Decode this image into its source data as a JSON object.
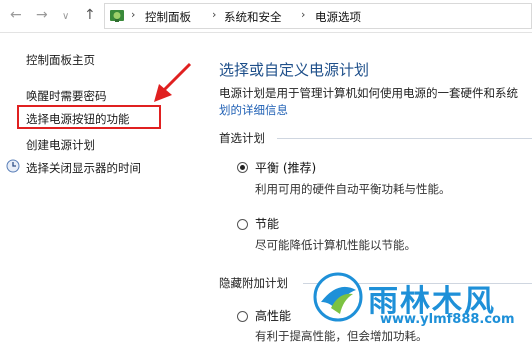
{
  "breadcrumb": {
    "items": [
      "控制面板",
      "系统和安全",
      "电源选项"
    ],
    "separator": "›"
  },
  "sidebar": {
    "items": [
      {
        "label": "控制面板主页"
      },
      {
        "label": "唤醒时需要密码"
      },
      {
        "label": "选择电源按钮的功能"
      },
      {
        "label": "创建电源计划"
      },
      {
        "label": "选择关闭显示器的时间"
      }
    ]
  },
  "main": {
    "title": "选择或自定义电源计划",
    "description": "电源计划是用于管理计算机如何使用电源的一套硬件和系统",
    "description_link": "划的详细信息",
    "preferred_heading": "首选计划",
    "plans": [
      {
        "name": "平衡 (推荐)",
        "desc": "利用可用的硬件自动平衡功耗与性能。",
        "checked": true
      },
      {
        "name": "节能",
        "desc": "尽可能降低计算机性能以节能。",
        "checked": false
      }
    ],
    "hidden_heading": "隐藏附加计划",
    "hidden_plans": [
      {
        "name": "高性能",
        "desc": "有利于提高性能，但会增加功耗。",
        "checked": false
      }
    ]
  },
  "watermark": {
    "brand": "雨林木风",
    "url": "www.ylmf888.com"
  },
  "colors": {
    "title_blue": "#1e4f8a",
    "link_blue": "#1e5fb4",
    "highlight_red": "#e02020",
    "watermark_blue": "#1e90d8",
    "watermark_green": "#7cc242"
  }
}
